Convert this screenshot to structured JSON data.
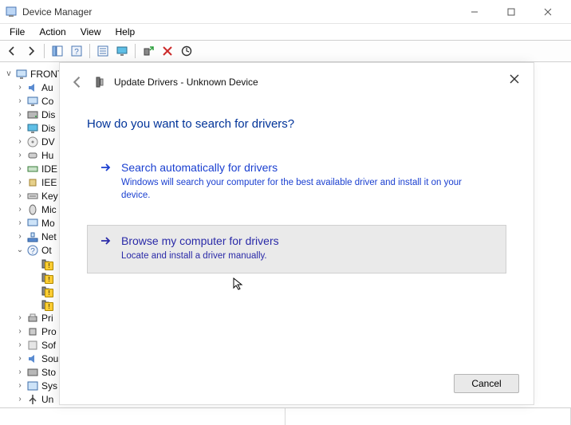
{
  "titlebar": {
    "title": "Device Manager"
  },
  "menu": {
    "items": [
      "File",
      "Action",
      "View",
      "Help"
    ]
  },
  "toolbar": {
    "icons": [
      "back-icon",
      "forward-icon",
      "sep",
      "show-hide-tree-icon",
      "help-topic-icon",
      "sep",
      "details-pane-icon",
      "monitor-icon",
      "sep",
      "scan-hardware-icon",
      "uninstall-icon",
      "update-driver-icon"
    ]
  },
  "tree": {
    "root": "FRONT",
    "nodes": [
      {
        "label": "Au",
        "icon": "audio",
        "twist": ">"
      },
      {
        "label": "Co",
        "icon": "computer",
        "twist": ">"
      },
      {
        "label": "Dis",
        "icon": "disk",
        "twist": ">"
      },
      {
        "label": "Dis",
        "icon": "display",
        "twist": ">"
      },
      {
        "label": "DV",
        "icon": "dvd",
        "twist": ">"
      },
      {
        "label": "Hu",
        "icon": "hid",
        "twist": ">"
      },
      {
        "label": "IDE",
        "icon": "ide",
        "twist": ">"
      },
      {
        "label": "IEE",
        "icon": "ieee",
        "twist": ">"
      },
      {
        "label": "Key",
        "icon": "keyboard",
        "twist": ">"
      },
      {
        "label": "Mic",
        "icon": "mouse",
        "twist": ">"
      },
      {
        "label": "Mo",
        "icon": "monitor",
        "twist": ">"
      },
      {
        "label": "Net",
        "icon": "network",
        "twist": ">"
      },
      {
        "label": "Ot",
        "icon": "other",
        "twist": "v"
      },
      {
        "label": "",
        "icon": "unknown",
        "twist": "",
        "indent": 1,
        "warn": true
      },
      {
        "label": "",
        "icon": "unknown",
        "twist": "",
        "indent": 1,
        "warn": true
      },
      {
        "label": "",
        "icon": "unknown",
        "twist": "",
        "indent": 1,
        "warn": true
      },
      {
        "label": "",
        "icon": "unknown",
        "twist": "",
        "indent": 1,
        "warn": true
      },
      {
        "label": "Pri",
        "icon": "printer",
        "twist": ">"
      },
      {
        "label": "Pro",
        "icon": "processor",
        "twist": ">"
      },
      {
        "label": "Sof",
        "icon": "software",
        "twist": ">"
      },
      {
        "label": "Sou",
        "icon": "sound",
        "twist": ">"
      },
      {
        "label": "Sto",
        "icon": "storage",
        "twist": ">"
      },
      {
        "label": "Sys",
        "icon": "system",
        "twist": ">"
      },
      {
        "label": "Un",
        "icon": "usb",
        "twist": ">"
      }
    ]
  },
  "wizard": {
    "breadcrumb": "Update Drivers - Unknown Device",
    "heading": "How do you want to search for drivers?",
    "option1": {
      "title": "Search automatically for drivers",
      "desc": "Windows will search your computer for the best available driver and install it on your device."
    },
    "option2": {
      "title": "Browse my computer for drivers",
      "desc": "Locate and install a driver manually."
    },
    "cancel": "Cancel"
  }
}
